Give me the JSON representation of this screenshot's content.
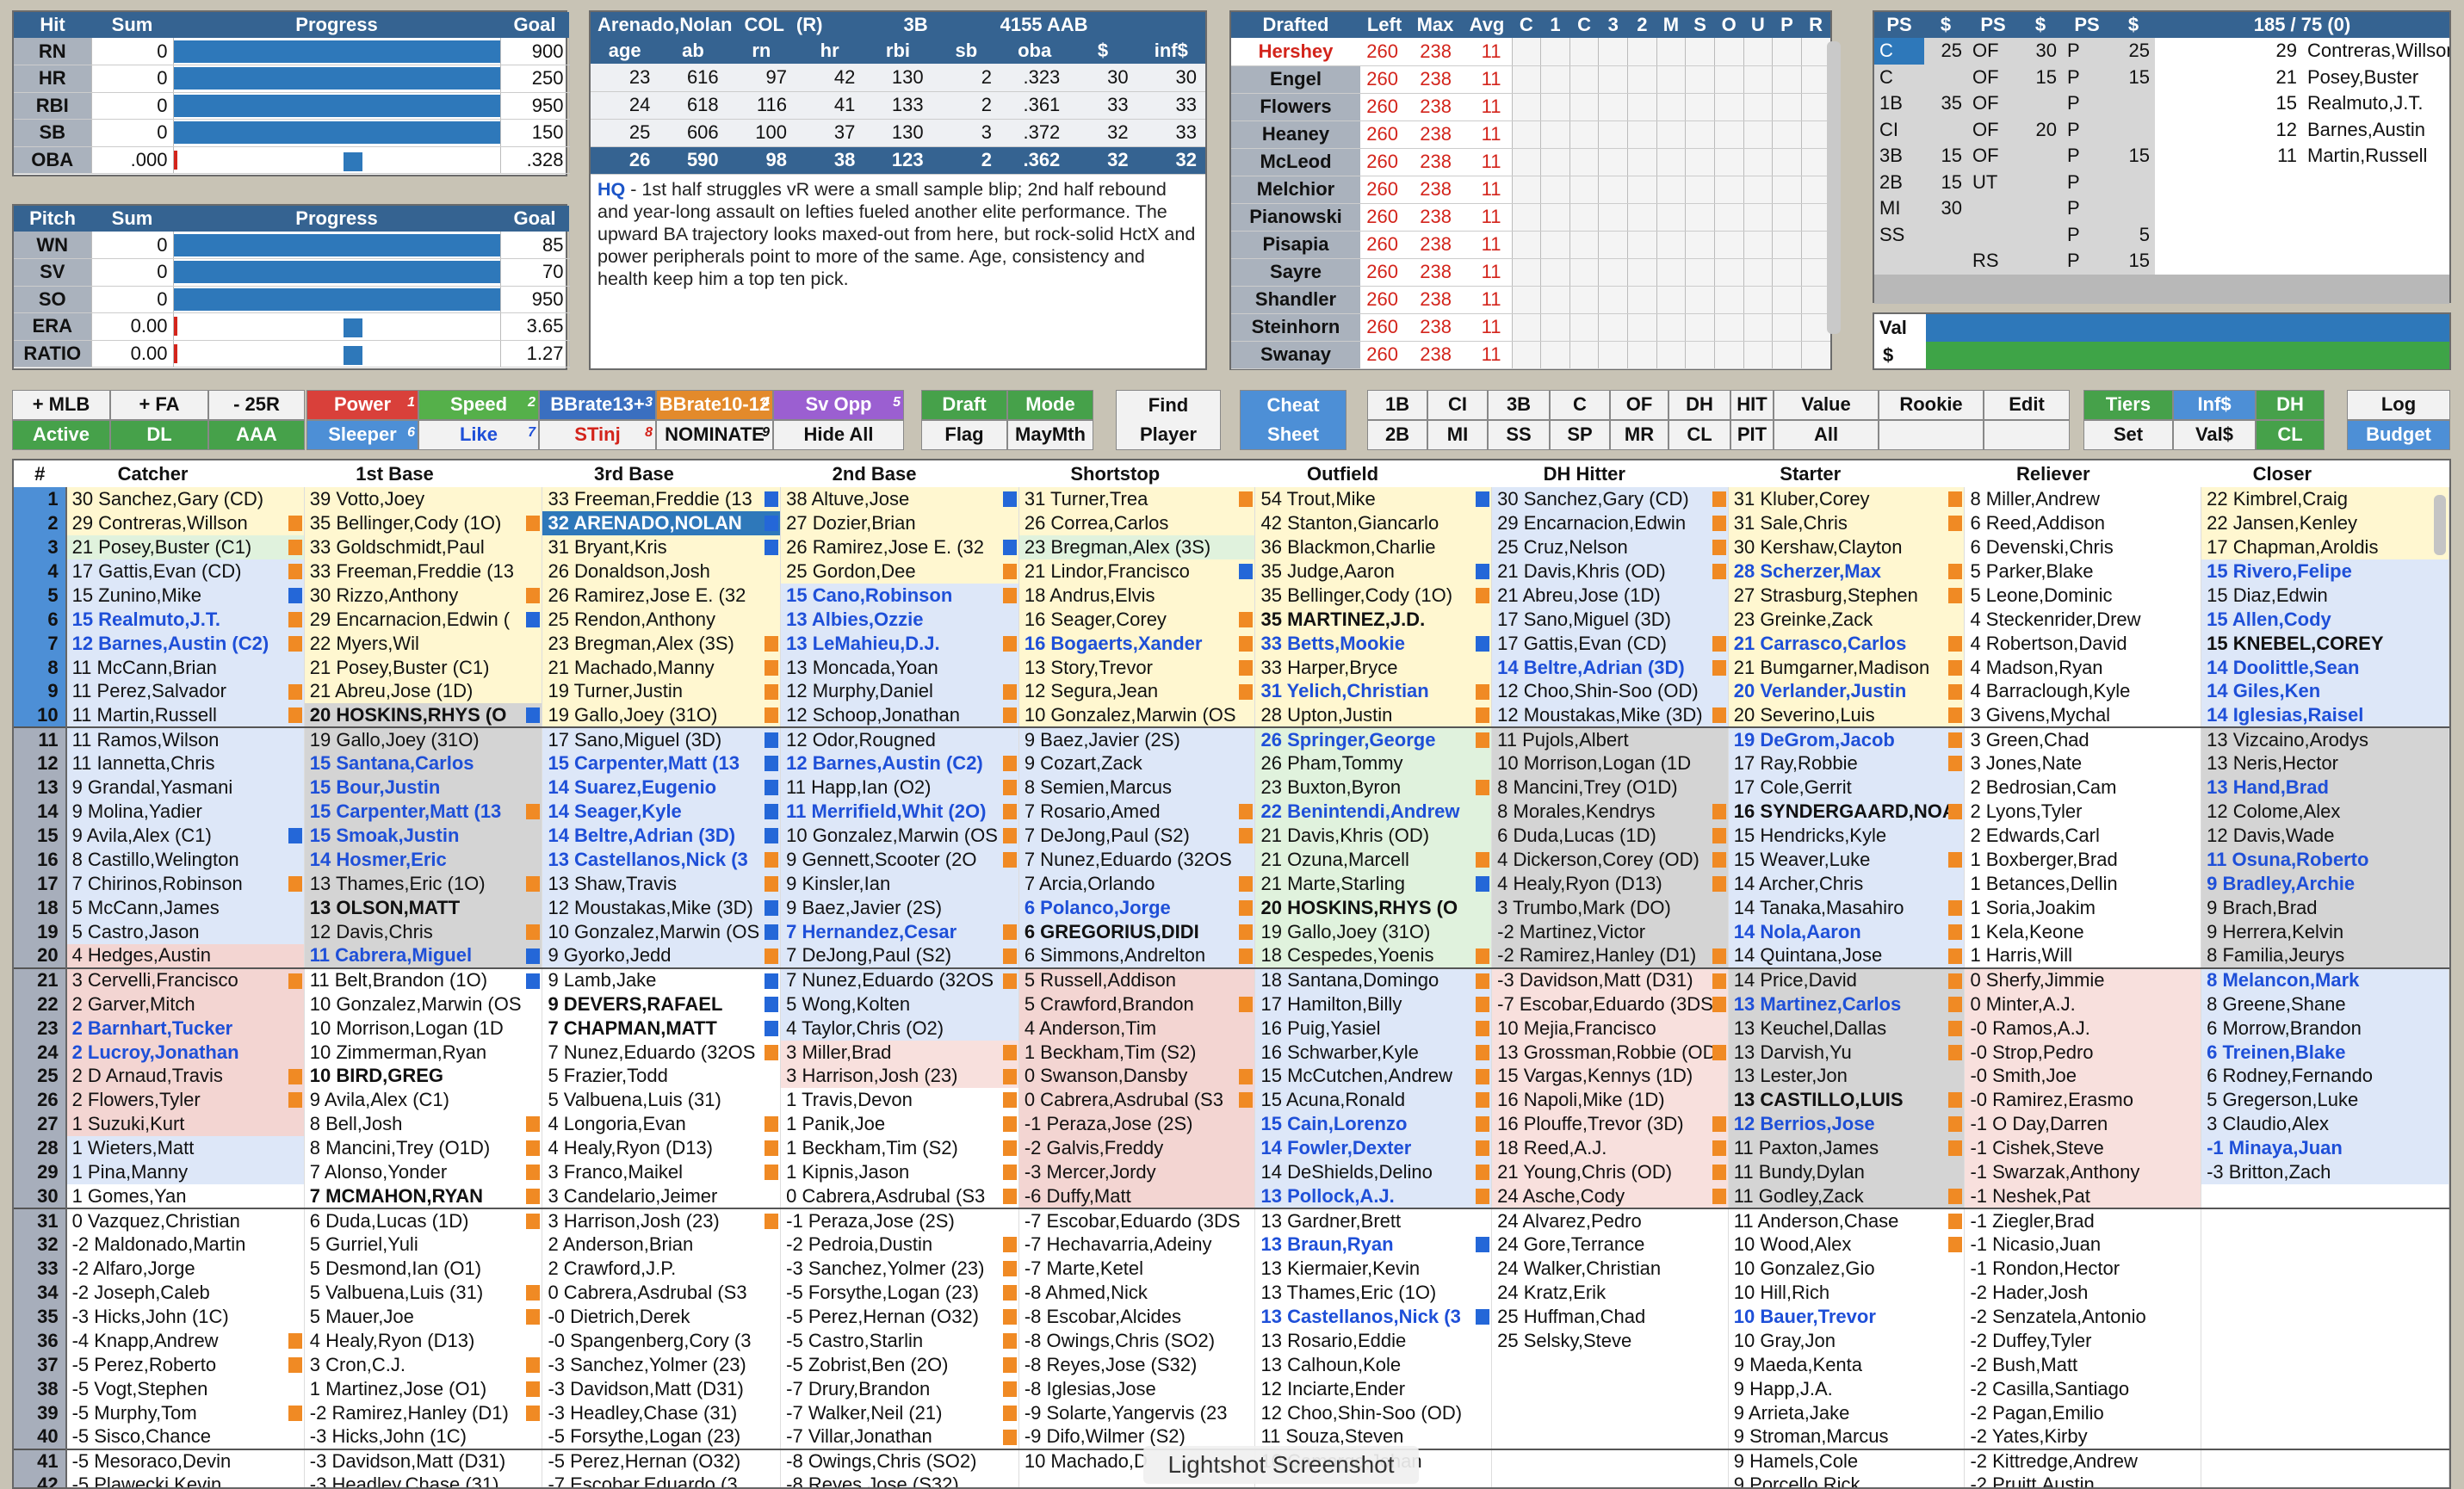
{
  "hit": {
    "headers": [
      "Hit",
      "Sum",
      "Progress",
      "Goal"
    ],
    "rows": [
      {
        "label": "RN",
        "sum": "0",
        "goal": "900",
        "pct": 1.0
      },
      {
        "label": "HR",
        "sum": "0",
        "goal": "250",
        "pct": 1.0
      },
      {
        "label": "RBI",
        "sum": "0",
        "goal": "950",
        "pct": 1.0
      },
      {
        "label": "SB",
        "sum": "0",
        "goal": "150",
        "pct": 1.0
      },
      {
        "label": "OBA",
        "sum": ".000",
        "goal": ".328",
        "pct": 0.0
      }
    ]
  },
  "pitch": {
    "headers": [
      "Pitch",
      "Sum",
      "Progress",
      "Goal"
    ],
    "rows": [
      {
        "label": "WN",
        "sum": "0",
        "goal": "85",
        "pct": 1.0
      },
      {
        "label": "SV",
        "sum": "0",
        "goal": "70",
        "pct": 1.0
      },
      {
        "label": "SO",
        "sum": "0",
        "goal": "950",
        "pct": 1.0
      },
      {
        "label": "ERA",
        "sum": "0.00",
        "goal": "3.65",
        "pct": 0.0
      },
      {
        "label": "RATIO",
        "sum": "0.00",
        "goal": "1.27",
        "pct": 0.0
      }
    ]
  },
  "player": {
    "name": "Arenado,Nolan",
    "team": "COL",
    "hand": "(R)",
    "pos": "3B",
    "aab": "4155 AAB",
    "headers": [
      "age",
      "ab",
      "rn",
      "hr",
      "rbi",
      "sb",
      "oba",
      "$",
      "inf$"
    ],
    "rows": [
      [
        "23",
        "616",
        "97",
        "42",
        "130",
        "2",
        ".323",
        "30",
        "30"
      ],
      [
        "24",
        "618",
        "116",
        "41",
        "133",
        "2",
        ".361",
        "33",
        "33"
      ],
      [
        "25",
        "606",
        "100",
        "37",
        "130",
        "3",
        ".372",
        "32",
        "33"
      ],
      [
        "26",
        "590",
        "98",
        "38",
        "123",
        "2",
        ".362",
        "32",
        "32"
      ]
    ],
    "note_tag": "HQ",
    "note": " - 1st half struggles vR were a small sample blip; 2nd half rebound and year-long assault on lefties fueled another elite performance. The upward BA trajectory looks maxed-out from here, but rock-solid HctX and power peripherals point to more of the same. Age, consistency and health keep him a top ten pick."
  },
  "drafted": {
    "headers": [
      "Drafted",
      "Left",
      "Max",
      "Avg",
      "C",
      "1",
      "C",
      "3",
      "2",
      "M",
      "S",
      "O",
      "U",
      "P",
      "R"
    ],
    "rows": [
      {
        "team": "Hershey",
        "left": "260",
        "max": "238",
        "avg": "11",
        "highlight": true
      },
      {
        "team": "Engel",
        "left": "260",
        "max": "238",
        "avg": "11"
      },
      {
        "team": "Flowers",
        "left": "260",
        "max": "238",
        "avg": "11"
      },
      {
        "team": "Heaney",
        "left": "260",
        "max": "238",
        "avg": "11"
      },
      {
        "team": "McLeod",
        "left": "260",
        "max": "238",
        "avg": "11"
      },
      {
        "team": "Melchior",
        "left": "260",
        "max": "238",
        "avg": "11"
      },
      {
        "team": "Pianowski",
        "left": "260",
        "max": "238",
        "avg": "11"
      },
      {
        "team": "Pisapia",
        "left": "260",
        "max": "238",
        "avg": "11"
      },
      {
        "team": "Sayre",
        "left": "260",
        "max": "238",
        "avg": "11"
      },
      {
        "team": "Shandler",
        "left": "260",
        "max": "238",
        "avg": "11"
      },
      {
        "team": "Steinhorn",
        "left": "260",
        "max": "238",
        "avg": "11"
      },
      {
        "team": "Swanay",
        "left": "260",
        "max": "238",
        "avg": "11"
      }
    ]
  },
  "roster": {
    "headers": [
      "PS",
      "$",
      "PS",
      "$",
      "PS",
      "$",
      "185 / 75  (0)"
    ],
    "rows": [
      [
        "C",
        "25",
        "OF",
        "30",
        "P",
        "25",
        "29",
        "Contreras,Willson"
      ],
      [
        "C",
        "",
        "OF",
        "15",
        "P",
        "15",
        "21",
        "Posey,Buster"
      ],
      [
        "1B",
        "35",
        "OF",
        "",
        "P",
        "",
        "15",
        "Realmuto,J.T."
      ],
      [
        "CI",
        "",
        "OF",
        "20",
        "P",
        "",
        "12",
        "Barnes,Austin"
      ],
      [
        "3B",
        "15",
        "OF",
        "",
        "P",
        "15",
        "11",
        "Martin,Russell"
      ],
      [
        "2B",
        "15",
        "UT",
        "",
        "P",
        "",
        "",
        ""
      ],
      [
        "MI",
        "30",
        "",
        "",
        "P",
        "",
        "",
        ""
      ],
      [
        "SS",
        "",
        "",
        "",
        "P",
        "5",
        "",
        ""
      ],
      [
        "",
        "",
        "RS",
        "",
        "P",
        "15",
        "",
        ""
      ]
    ],
    "val_label": "Val",
    "dollar_label": "$"
  },
  "toolbar": {
    "mlb": "+ MLB",
    "fa": "+ FA",
    "r25": "- 25R",
    "active": "Active",
    "dl": "DL",
    "aaa": "AAA",
    "power": "Power",
    "power_n": "1",
    "speed": "Speed",
    "speed_n": "2",
    "bbrate13": "BBrate13+",
    "bbrate13_n": "3",
    "bbrate10": "BBrate10-12",
    "bbrate10_n": "4",
    "svopp": "Sv Opp",
    "svopp_n": "5",
    "sleeper": "Sleeper",
    "sleeper_n": "6",
    "like": "Like",
    "like_n": "7",
    "stinj": "STinj",
    "stinj_n": "8",
    "nominate": "NOMINATE",
    "nominate_n": "9",
    "hideall": "Hide All",
    "draft": "Draft",
    "mode": "Mode",
    "flag": "Flag",
    "maymth": "MayMth",
    "find": "Find",
    "player": "Player",
    "cheat": "Cheat",
    "sheet": "Sheet",
    "pos1": [
      "1B",
      "CI",
      "3B",
      "C",
      "OF",
      "DH",
      "HIT"
    ],
    "pos2": [
      "2B",
      "MI",
      "SS",
      "SP",
      "MR",
      "CL",
      "PIT"
    ],
    "value": "Value",
    "rookie": "Rookie",
    "edit": "Edit",
    "all": "All",
    "tiers": "Tiers",
    "inf": "Inf$",
    "dh": "DH",
    "set": "Set",
    "vals": "Val$",
    "cl": "CL",
    "log": "Log",
    "budget": "Budget"
  },
  "grid": {
    "headers": [
      "#",
      "Catcher",
      "1st Base",
      "3rd Base",
      "2nd Base",
      "Shortstop",
      "Outfield",
      "DH Hitter",
      "Starter",
      "Reliever",
      "Closer"
    ],
    "rows": [
      [
        "1",
        "30 Sanchez,Gary (CD)",
        "39 Votto,Joey",
        "33 Freeman,Freddie (13",
        "38 Altuve,Jose",
        "31 Turner,Trea",
        "54 Trout,Mike",
        "30 Sanchez,Gary (CD)",
        "31 Kluber,Corey",
        "8 Miller,Andrew",
        "22 Kimbrel,Craig"
      ],
      [
        "2",
        "29 Contreras,Willson",
        "35 Bellinger,Cody (1O)",
        "32 ARENADO,NOLAN",
        "27 Dozier,Brian",
        "26 Correa,Carlos",
        "42 Stanton,Giancarlo",
        "29 Encarnacion,Edwin",
        "31 Sale,Chris",
        "6 Reed,Addison",
        "22 Jansen,Kenley"
      ],
      [
        "3",
        "21 Posey,Buster (C1)",
        "33 Goldschmidt,Paul",
        "31 Bryant,Kris",
        "26 Ramirez,Jose E. (32",
        "23 Bregman,Alex (3S)",
        "36 Blackmon,Charlie",
        "25 Cruz,Nelson",
        "30 Kershaw,Clayton",
        "6 Devenski,Chris",
        "17 Chapman,Aroldis"
      ],
      [
        "4",
        "17 Gattis,Evan (CD)",
        "33 Freeman,Freddie (13",
        "26 Donaldson,Josh",
        "25 Gordon,Dee",
        "21 Lindor,Francisco",
        "35 Judge,Aaron",
        "21 Davis,Khris (OD)",
        "28 Scherzer,Max",
        "5 Parker,Blake",
        "15 Rivero,Felipe"
      ],
      [
        "5",
        "15 Zunino,Mike",
        "30 Rizzo,Anthony",
        "26 Ramirez,Jose E. (32",
        "15 Cano,Robinson",
        "18 Andrus,Elvis",
        "35 Bellinger,Cody (1O)",
        "21 Abreu,Jose (1D)",
        "27 Strasburg,Stephen",
        "5 Leone,Dominic",
        "15 Diaz,Edwin"
      ],
      [
        "6",
        "15 Realmuto,J.T.",
        "29 Encarnacion,Edwin (",
        "25 Rendon,Anthony",
        "13 Albies,Ozzie",
        "16 Seager,Corey",
        "35 MARTINEZ,J.D.",
        "17 Sano,Miguel (3D)",
        "23 Greinke,Zack",
        "4 Steckenrider,Drew",
        "15 Allen,Cody"
      ],
      [
        "7",
        "12 Barnes,Austin (C2)",
        "22 Myers,Wil",
        "23 Bregman,Alex (3S)",
        "13 LeMahieu,D.J.",
        "16 Bogaerts,Xander",
        "33 Betts,Mookie",
        "17 Gattis,Evan (CD)",
        "21 Carrasco,Carlos",
        "4 Robertson,David",
        "15 KNEBEL,COREY"
      ],
      [
        "8",
        "11 McCann,Brian",
        "21 Posey,Buster (C1)",
        "21 Machado,Manny",
        "13 Moncada,Yoan",
        "13 Story,Trevor",
        "33 Harper,Bryce",
        "14 Beltre,Adrian (3D)",
        "21 Bumgarner,Madison",
        "4 Madson,Ryan",
        "14 Doolittle,Sean"
      ],
      [
        "9",
        "11 Perez,Salvador",
        "21 Abreu,Jose (1D)",
        "19 Turner,Justin",
        "12 Murphy,Daniel",
        "12 Segura,Jean",
        "31 Yelich,Christian",
        "12 Choo,Shin-Soo (OD)",
        "20 Verlander,Justin",
        "4 Barraclough,Kyle",
        "14 Giles,Ken"
      ],
      [
        "10",
        "11 Martin,Russell",
        "20 HOSKINS,RHYS (O",
        "19 Gallo,Joey (31O)",
        "12 Schoop,Jonathan",
        "10 Gonzalez,Marwin (OS",
        "28 Upton,Justin",
        "12 Moustakas,Mike (3D)",
        "20 Severino,Luis",
        "3 Givens,Mychal",
        "14 Iglesias,Raisel"
      ],
      [
        "11",
        "11 Ramos,Wilson",
        "19 Gallo,Joey (31O)",
        "17 Sano,Miguel (3D)",
        "12 Odor,Rougned",
        "9 Baez,Javier (2S)",
        "26 Springer,George",
        "11 Pujols,Albert",
        "19 DeGrom,Jacob",
        "3 Green,Chad",
        "13 Vizcaino,Arodys"
      ],
      [
        "12",
        "11 Iannetta,Chris",
        "15 Santana,Carlos",
        "15 Carpenter,Matt (13",
        "12 Barnes,Austin (C2)",
        "9 Cozart,Zack",
        "26 Pham,Tommy",
        "10 Morrison,Logan (1D",
        "17 Ray,Robbie",
        "3 Jones,Nate",
        "13 Neris,Hector"
      ],
      [
        "13",
        "9 Grandal,Yasmani",
        "15 Bour,Justin",
        "14 Suarez,Eugenio",
        "11 Happ,Ian (O2)",
        "8 Semien,Marcus",
        "23 Buxton,Byron",
        "8 Mancini,Trey (O1D)",
        "17 Cole,Gerrit",
        "2 Bedrosian,Cam",
        "13 Hand,Brad"
      ],
      [
        "14",
        "9 Molina,Yadier",
        "15 Carpenter,Matt (13",
        "14 Seager,Kyle",
        "11 Merrifield,Whit (2O)",
        "7 Rosario,Amed",
        "22 Benintendi,Andrew",
        "8 Morales,Kendrys",
        "16 SYNDERGAARD,NOA",
        "2 Lyons,Tyler",
        "12 Colome,Alex"
      ],
      [
        "15",
        "9 Avila,Alex (C1)",
        "15 Smoak,Justin",
        "14 Beltre,Adrian (3D)",
        "10 Gonzalez,Marwin (OS",
        "7 DeJong,Paul (S2)",
        "21 Davis,Khris (OD)",
        "6 Duda,Lucas (1D)",
        "15 Hendricks,Kyle",
        "2 Edwards,Carl",
        "12 Davis,Wade"
      ],
      [
        "16",
        "8 Castillo,Welington",
        "14 Hosmer,Eric",
        "13 Castellanos,Nick (3",
        "9 Gennett,Scooter (2O",
        "7 Nunez,Eduardo (32OS",
        "21 Ozuna,Marcell",
        "4 Dickerson,Corey (OD)",
        "15 Weaver,Luke",
        "1 Boxberger,Brad",
        "11 Osuna,Roberto"
      ],
      [
        "17",
        "7 Chirinos,Robinson",
        "13 Thames,Eric (1O)",
        "13 Shaw,Travis",
        "9 Kinsler,Ian",
        "7 Arcia,Orlando",
        "21 Marte,Starling",
        "4 Healy,Ryon (D13)",
        "14 Archer,Chris",
        "1 Betances,Dellin",
        "9 Bradley,Archie"
      ],
      [
        "18",
        "5 McCann,James",
        "13 OLSON,MATT",
        "12 Moustakas,Mike (3D)",
        "9 Baez,Javier (2S)",
        "6 Polanco,Jorge",
        "20 HOSKINS,RHYS (O",
        "3 Trumbo,Mark (DO)",
        "14 Tanaka,Masahiro",
        "1 Soria,Joakim",
        "9 Brach,Brad"
      ],
      [
        "19",
        "5 Castro,Jason",
        "12 Davis,Chris",
        "10 Gonzalez,Marwin (OS",
        "7 Hernandez,Cesar",
        "6 GREGORIUS,DIDI",
        "19 Gallo,Joey (31O)",
        "-2 Martinez,Victor",
        "14 Nola,Aaron",
        "1 Kela,Keone",
        "9 Herrera,Kelvin"
      ],
      [
        "20",
        "4 Hedges,Austin",
        "11 Cabrera,Miguel",
        "9 Gyorko,Jedd",
        "7 DeJong,Paul (S2)",
        "6 Simmons,Andrelton",
        "18 Cespedes,Yoenis",
        "-2 Ramirez,Hanley (D1)",
        "14 Quintana,Jose",
        "1 Harris,Will",
        "8 Familia,Jeurys"
      ],
      [
        "21",
        "3 Cervelli,Francisco",
        "11 Belt,Brandon (1O)",
        "9 Lamb,Jake",
        "7 Nunez,Eduardo (32OS",
        "5 Russell,Addison",
        "18 Santana,Domingo",
        "-3 Davidson,Matt (D31)",
        "14 Price,David",
        "0 Sherfy,Jimmie",
        "8 Melancon,Mark"
      ],
      [
        "22",
        "2 Garver,Mitch",
        "10 Gonzalez,Marwin (OS",
        "9 DEVERS,RAFAEL",
        "5 Wong,Kolten",
        "5 Crawford,Brandon",
        "17 Hamilton,Billy",
        "-7 Escobar,Eduardo (3DS",
        "13 Martinez,Carlos",
        "0 Minter,A.J.",
        "8 Greene,Shane"
      ],
      [
        "23",
        "2 Barnhart,Tucker",
        "10 Morrison,Logan (1D",
        "7 CHAPMAN,MATT",
        "4 Taylor,Chris (O2)",
        "4 Anderson,Tim",
        "16 Puig,Yasiel",
        "10 Mejia,Francisco",
        "13 Keuchel,Dallas",
        "-0 Ramos,A.J.",
        "6 Morrow,Brandon"
      ],
      [
        "24",
        "2 Lucroy,Jonathan",
        "10 Zimmerman,Ryan",
        "7 Nunez,Eduardo (32OS",
        "3 Miller,Brad",
        "1 Beckham,Tim (S2)",
        "16 Schwarber,Kyle",
        "13 Grossman,Robbie (OD",
        "13 Darvish,Yu",
        "-0 Strop,Pedro",
        "6 Treinen,Blake"
      ],
      [
        "25",
        "2 D Arnaud,Travis",
        "10 BIRD,GREG",
        "5 Frazier,Todd",
        "3 Harrison,Josh (23)",
        "0 Swanson,Dansby",
        "15 McCutchen,Andrew",
        "15 Vargas,Kennys (1D)",
        "13 Lester,Jon",
        "-0 Smith,Joe",
        "6 Rodney,Fernando"
      ],
      [
        "26",
        "2 Flowers,Tyler",
        "9 Avila,Alex (C1)",
        "5 Valbuena,Luis (31)",
        "1 Travis,Devon",
        "0 Cabrera,Asdrubal (S3",
        "15 Acuna,Ronald",
        "16 Napoli,Mike (1D)",
        "13 CASTILLO,LUIS",
        "-0 Ramirez,Erasmo",
        "5 Gregerson,Luke"
      ],
      [
        "27",
        "1 Suzuki,Kurt",
        "8 Bell,Josh",
        "4 Longoria,Evan",
        "1 Panik,Joe",
        "-1 Peraza,Jose (2S)",
        "15 Cain,Lorenzo",
        "16 Plouffe,Trevor (3D)",
        "12 Berrios,Jose",
        "-1 O Day,Darren",
        "3 Claudio,Alex"
      ],
      [
        "28",
        "1 Wieters,Matt",
        "8 Mancini,Trey (O1D)",
        "4 Healy,Ryon (D13)",
        "1 Beckham,Tim (S2)",
        "-2 Galvis,Freddy",
        "14 Fowler,Dexter",
        "18 Reed,A.J.",
        "11 Paxton,James",
        "-1 Cishek,Steve",
        "-1 Minaya,Juan"
      ],
      [
        "29",
        "1 Pina,Manny",
        "7 Alonso,Yonder",
        "3 Franco,Maikel",
        "1 Kipnis,Jason",
        "-3 Mercer,Jordy",
        "14 DeShields,Delino",
        "21 Young,Chris (OD)",
        "11 Bundy,Dylan",
        "-1 Swarzak,Anthony",
        "-3 Britton,Zach"
      ],
      [
        "30",
        "1 Gomes,Yan",
        "7 MCMAHON,RYAN",
        "3 Candelario,Jeimer",
        "0 Cabrera,Asdrubal (S3",
        "-6 Duffy,Matt",
        "13 Pollock,A.J.",
        "24 Asche,Cody",
        "11 Godley,Zack",
        "-1 Neshek,Pat",
        ""
      ],
      [
        "31",
        "0 Vazquez,Christian",
        "6 Duda,Lucas (1D)",
        "3 Harrison,Josh (23)",
        "-1 Peraza,Jose (2S)",
        "-7 Escobar,Eduardo (3DS",
        "13 Gardner,Brett",
        "24 Alvarez,Pedro",
        "11 Anderson,Chase",
        "-1 Ziegler,Brad",
        ""
      ],
      [
        "32",
        "-2 Maldonado,Martin",
        "5 Gurriel,Yuli",
        "2 Anderson,Brian",
        "-2 Pedroia,Dustin",
        "-7 Hechavarria,Adeiny",
        "13 Braun,Ryan",
        "24 Gore,Terrance",
        "10 Wood,Alex",
        "-1 Nicasio,Juan",
        ""
      ],
      [
        "33",
        "-2 Alfaro,Jorge",
        "5 Desmond,Ian (O1)",
        "2 Crawford,J.P.",
        "-3 Sanchez,Yolmer (23)",
        "-7 Marte,Ketel",
        "13 Kiermaier,Kevin",
        "24 Walker,Christian",
        "10 Gonzalez,Gio",
        "-1 Rondon,Hector",
        ""
      ],
      [
        "34",
        "-2 Joseph,Caleb",
        "5 Valbuena,Luis (31)",
        "0 Cabrera,Asdrubal (S3",
        "-5 Forsythe,Logan (23)",
        "-8 Ahmed,Nick",
        "13 Thames,Eric (1O)",
        "24 Kratz,Erik",
        "10 Hill,Rich",
        "-2 Hader,Josh",
        ""
      ],
      [
        "35",
        "-3 Hicks,John (1C)",
        "5 Mauer,Joe",
        "-0 Dietrich,Derek",
        "-5 Perez,Hernan (O32)",
        "-8 Escobar,Alcides",
        "13 Castellanos,Nick (3",
        "25 Huffman,Chad",
        "10 Bauer,Trevor",
        "-2 Senzatela,Antonio",
        ""
      ],
      [
        "36",
        "-4 Knapp,Andrew",
        "4 Healy,Ryon (D13)",
        "-0 Spangenberg,Cory (3",
        "-5 Castro,Starlin",
        "-8 Owings,Chris (SO2)",
        "13 Rosario,Eddie",
        "25 Selsky,Steve",
        "10 Gray,Jon",
        "-2 Duffey,Tyler",
        ""
      ],
      [
        "37",
        "-5 Perez,Roberto",
        "3 Cron,C.J.",
        "-3 Sanchez,Yolmer (23)",
        "-5 Zobrist,Ben (2O)",
        "-8 Reyes,Jose (S32)",
        "13 Calhoun,Kole",
        "",
        "9 Maeda,Kenta",
        "-2 Bush,Matt",
        ""
      ],
      [
        "38",
        "-5 Vogt,Stephen",
        "1 Martinez,Jose (O1)",
        "-3 Davidson,Matt (D31)",
        "-7 Drury,Brandon",
        "-8 Iglesias,Jose",
        "12 Inciarte,Ender",
        "",
        "9 Happ,J.A.",
        "-2 Casilla,Santiago",
        ""
      ],
      [
        "39",
        "-5 Murphy,Tom",
        "-2 Ramirez,Hanley (D1)",
        "-3 Headley,Chase (31)",
        "-7 Walker,Neil (21)",
        "-9 Solarte,Yangervis (23",
        "12 Choo,Shin-Soo (OD)",
        "",
        "9 Arrieta,Jake",
        "-2 Pagan,Emilio",
        ""
      ],
      [
        "40",
        "-5 Sisco,Chance",
        "-3 Hicks,John (1C)",
        "-5 Forsythe,Logan (23)",
        "-7 Villar,Jonathan",
        "-9 Difo,Wilmer (S2)",
        "11 Souza,Steven",
        "",
        "9 Stroman,Marcus",
        "-2 Yates,Kirby",
        ""
      ],
      [
        "41",
        "-5 Mesoraco,Devin",
        "-3 Davidson,Matt (D31)",
        "-5 Perez,Hernan (O32)",
        "-8 Owings,Chris (SO2)",
        "10 Machado,D",
        "10 Camargo,Johan",
        "",
        "9 Hamels,Cole",
        "-2 Kittredge,Andrew",
        ""
      ],
      [
        "42",
        "-5 Plawecki,Kevin",
        "-3 Headley,Chase (31)",
        "-7 Escobar,Eduardo (3",
        "-8 Reyes,Jose (S32)",
        "",
        "",
        "",
        "9 Porcello,Rick",
        "-2 Pruitt,Austin",
        ""
      ]
    ]
  },
  "lightshot": "Lightshot Screenshot"
}
